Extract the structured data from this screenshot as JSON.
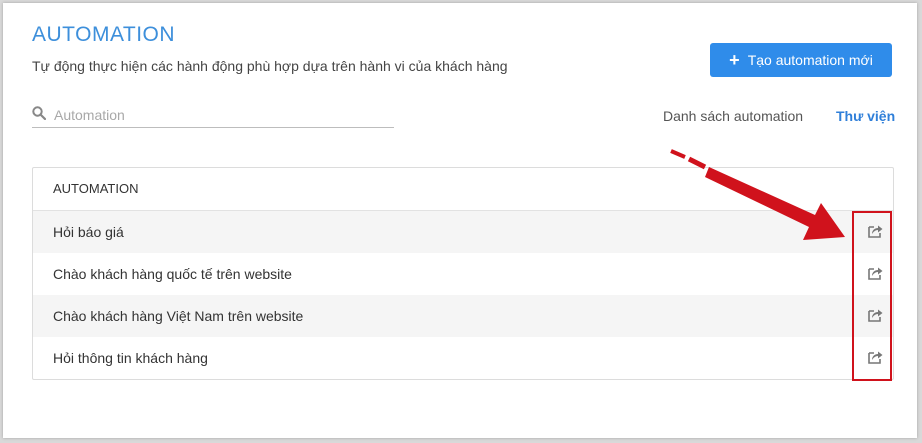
{
  "header": {
    "title": "AUTOMATION",
    "subtitle": "Tự động thực hiện các hành động phù hợp dựa trên hành vi của khách hàng",
    "create_button_label": "Tạo automation mới",
    "create_button_icon": "plus-icon"
  },
  "search": {
    "placeholder": "Automation",
    "value": "",
    "icon": "search-icon"
  },
  "tabs": {
    "list_label": "Danh sách automation",
    "library_label": "Thư viện"
  },
  "table": {
    "header": "AUTOMATION",
    "rows": [
      {
        "name": "Hỏi báo giá",
        "action_icon": "share-icon"
      },
      {
        "name": "Chào khách hàng quốc tế trên website",
        "action_icon": "share-icon"
      },
      {
        "name": "Chào khách hàng Việt Nam trên website",
        "action_icon": "share-icon"
      },
      {
        "name": "Hỏi thông tin khách hàng",
        "action_icon": "share-icon"
      }
    ]
  },
  "colors": {
    "accent": "#2f8cea",
    "title": "#3d8fdb",
    "annotation": "#d0121c"
  }
}
